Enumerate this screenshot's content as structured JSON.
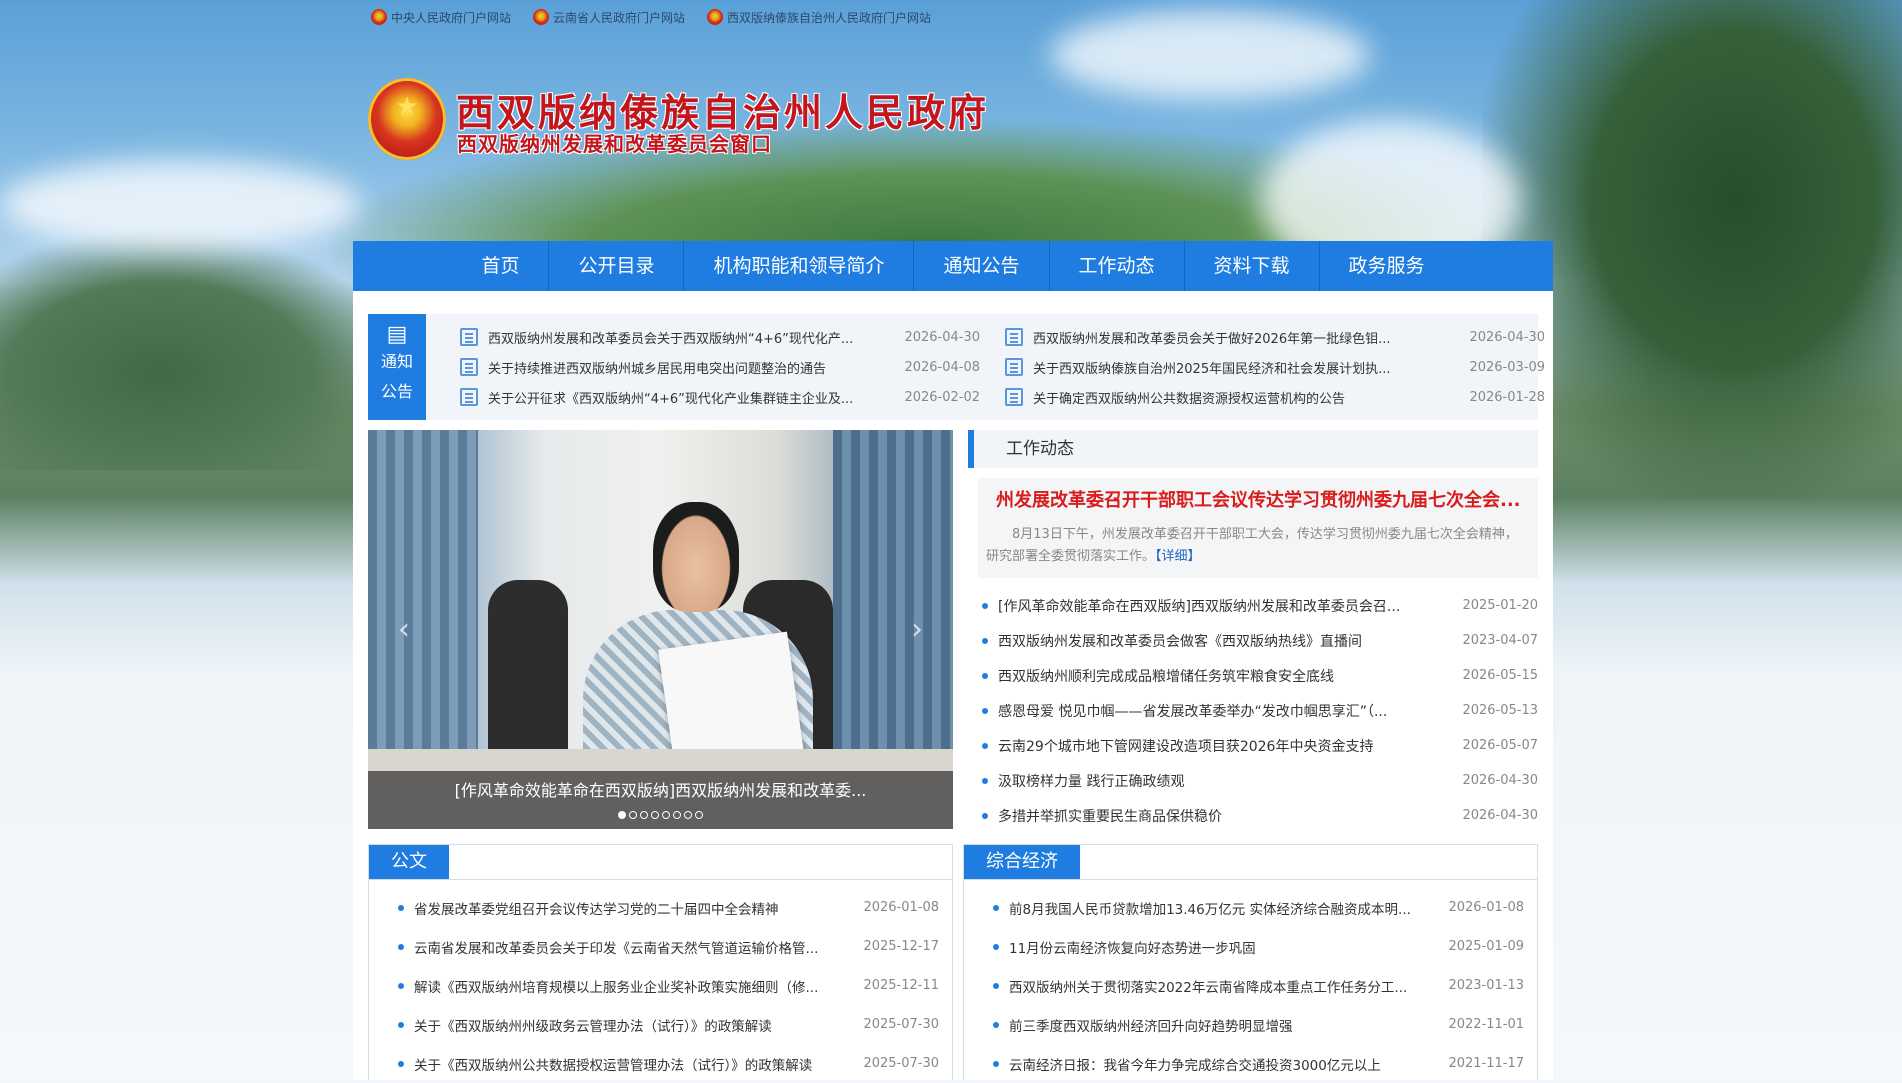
{
  "top_links": [
    "中央人民政府门户网站",
    "云南省人民政府门户网站",
    "西双版纳傣族自治州人民政府门户网站"
  ],
  "header": {
    "title": "西双版纳傣族自治州人民政府",
    "subtitle": "西双版纳州发展和改革委员会窗口"
  },
  "nav": [
    "首页",
    "公开目录",
    "机构职能和领导简介",
    "通知公告",
    "工作动态",
    "资料下载",
    "政务服务"
  ],
  "notice": {
    "label_line1": "通知",
    "label_line2": "公告",
    "items": [
      {
        "title": "西双版纳州发展和改革委员会关于西双版纳州“4+6”现代化产...",
        "date": "2026-04-30"
      },
      {
        "title": "西双版纳州发展和改革委员会关于做好2026年第一批绿色钼...",
        "date": "2026-04-30"
      },
      {
        "title": "关于持续推进西双版纳州城乡居民用电突出问题整治的通告",
        "date": "2026-04-08"
      },
      {
        "title": "关于西双版纳傣族自治州2025年国民经济和社会发展计划执...",
        "date": "2026-03-09"
      },
      {
        "title": "关于公开征求《西双版纳州“4+6”现代化产业集群链主企业及...",
        "date": "2026-02-02"
      },
      {
        "title": "关于确定西双版纳州公共数据资源授权运营机构的公告",
        "date": "2026-01-28"
      }
    ]
  },
  "slider": {
    "caption": "[作风革命效能革命在西双版纳]西双版纳州发展和改革委...",
    "slide_count": 8,
    "active_index": 0
  },
  "work": {
    "heading": "工作动态",
    "feature_title": "州发展改革委召开干部职工会议传达学习贯彻州委九届七次全会...",
    "feature_desc": "8月13日下午，州发展改革委召开干部职工大会，传达学习贯彻州委九届七次全会精神，研究部署全委贯彻落实工作。",
    "detail_label": "【详细】",
    "items": [
      {
        "title": "[作风革命效能革命在西双版纳]西双版纳州发展和改革委员会召...",
        "date": "2025-01-20"
      },
      {
        "title": "西双版纳州发展和改革委员会做客《西双版纳热线》直播间",
        "date": "2023-04-07"
      },
      {
        "title": "西双版纳州顺利完成成品粮增储任务筑牢粮食安全底线",
        "date": "2026-05-15"
      },
      {
        "title": "感恩母爱 悦见巾帼——省发展改革委举办“发改巾帼思享汇”（...",
        "date": "2026-05-13"
      },
      {
        "title": "云南29个城市地下管网建设改造项目获2026年中央资金支持",
        "date": "2026-05-07"
      },
      {
        "title": "汲取榜样力量 践行正确政绩观",
        "date": "2026-04-30"
      },
      {
        "title": "多措并举抓实重要民生商品保供稳价",
        "date": "2026-04-30"
      }
    ]
  },
  "gongwen": {
    "tab": "公文",
    "items": [
      {
        "title": "省发展改革委党组召开会议传达学习党的二十届四中全会精神",
        "date": "2026-01-08"
      },
      {
        "title": "云南省发展和改革委员会关于印发《云南省天然气管道运输价格管...",
        "date": "2025-12-17"
      },
      {
        "title": "解读《西双版纳州培育规模以上服务业企业奖补政策实施细则（修...",
        "date": "2025-12-11"
      },
      {
        "title": "关于《西双版纳州州级政务云管理办法（试行）》的政策解读",
        "date": "2025-07-30"
      },
      {
        "title": "关于《西双版纳州公共数据授权运营管理办法（试行）》的政策解读",
        "date": "2025-07-30"
      }
    ]
  },
  "economy": {
    "tab": "综合经济",
    "items": [
      {
        "title": "前8月我国人民币贷款增加13.46万亿元 实体经济综合融资成本明...",
        "date": "2026-01-08"
      },
      {
        "title": "11月份云南经济恢复向好态势进一步巩固",
        "date": "2025-01-09"
      },
      {
        "title": "西双版纳州关于贯彻落实2022年云南省降成本重点工作任务分工...",
        "date": "2023-01-13"
      },
      {
        "title": "前三季度西双版纳州经济回升向好趋势明显增强",
        "date": "2022-11-01"
      },
      {
        "title": "云南经济日报：我省今年力争完成综合交通投资3000亿元以上",
        "date": "2021-11-17"
      }
    ]
  },
  "colors": {
    "accent": "#1f7ce0",
    "title_red": "#c3161c",
    "feature_red": "#d91c1c"
  }
}
